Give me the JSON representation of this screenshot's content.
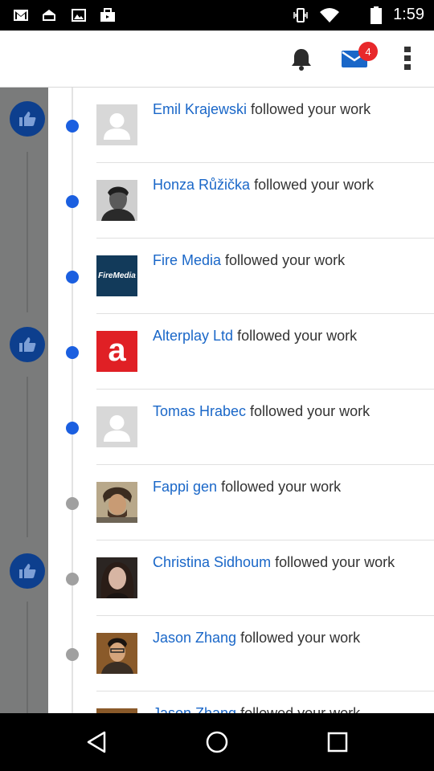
{
  "status_bar": {
    "time": "1:59",
    "left_icons": [
      "gmail-icon",
      "inbox-icon",
      "image-icon",
      "briefcase-icon"
    ],
    "right_icons": [
      "vibrate-icon",
      "wifi-icon",
      "battery-icon"
    ]
  },
  "app_bar": {
    "notifications_icon": "bell-icon",
    "mail_icon": "mail-icon",
    "mail_badge": "4",
    "overflow_icon": "more-vert-icon"
  },
  "colors": {
    "accent_blue": "#1a67c8",
    "dot_unread": "#1b5fe0",
    "dot_read": "#a0a0a0",
    "badge_red": "#e8282b",
    "rail_gray": "#7a7b7b",
    "like_blue": "#0d3f8e"
  },
  "feed": {
    "items": [
      {
        "name": "Emil Krajewski",
        "action": " followed your work",
        "unread": true,
        "avatar": "placeholder"
      },
      {
        "name": "Honza Růžička",
        "action": " followed your work",
        "unread": true,
        "avatar": "photo"
      },
      {
        "name": "Fire Media",
        "action": " followed your work",
        "unread": true,
        "avatar": "firemedia-logo",
        "logo_text": "FireMedia"
      },
      {
        "name": "Alterplay Ltd",
        "action": " followed your work",
        "unread": true,
        "avatar": "alterplay-logo",
        "logo_text": "a"
      },
      {
        "name": "Tomas Hrabec",
        "action": " followed your work",
        "unread": true,
        "avatar": "placeholder"
      },
      {
        "name": "Fappi gen",
        "action": " followed your work",
        "unread": false,
        "avatar": "photo"
      },
      {
        "name": "Christina Sidhoum",
        "action": " followed your work",
        "unread": false,
        "avatar": "photo"
      },
      {
        "name": "Jason Zhang",
        "action": " followed your work",
        "unread": false,
        "avatar": "photo"
      },
      {
        "name": "Jason Zhang",
        "action": " followed your work",
        "unread": false,
        "avatar": "photo"
      }
    ]
  },
  "nav_bar": {
    "back_icon": "back-triangle-icon",
    "home_icon": "home-circle-icon",
    "recents_icon": "recents-square-icon"
  }
}
